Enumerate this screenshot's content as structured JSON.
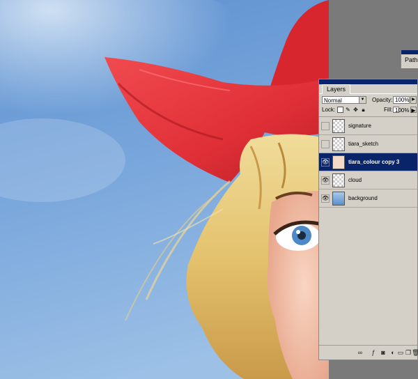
{
  "paths_palette": {
    "tab_label": "Paths"
  },
  "layers_palette": {
    "tab_label": "Layers",
    "blend_mode": "Normal",
    "opacity_label": "Opacity:",
    "opacity_value": "100%",
    "lock_label": "Lock:",
    "fill_label": "Fill:",
    "fill_value": "100%",
    "layers": [
      {
        "name": "signature",
        "visible": false,
        "active": false
      },
      {
        "name": "tiara_sketch",
        "visible": false,
        "active": false
      },
      {
        "name": "tiara_colour copy 3",
        "visible": true,
        "active": true
      },
      {
        "name": "cloud",
        "visible": true,
        "active": false
      },
      {
        "name": "background",
        "visible": true,
        "active": false
      }
    ]
  },
  "icons": [
    "eye-icon",
    "brush-icon",
    "lock-icon",
    "move-icon",
    "link-icon",
    "layer-style-icon",
    "mask-icon",
    "adjustment-layer-icon",
    "new-set-icon",
    "new-layer-icon",
    "trash-icon"
  ],
  "colors": {
    "sky": "#6fa0d8",
    "hat_red": "#e8333a",
    "hair_blonde": "#e6c877",
    "ui_gray": "#d4d0c8",
    "selection_blue": "#0a246a"
  }
}
